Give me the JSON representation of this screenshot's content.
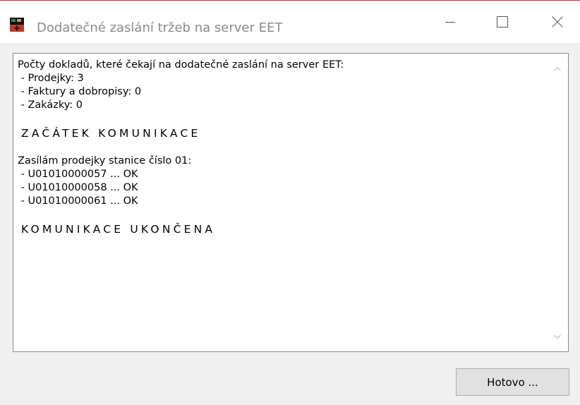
{
  "window": {
    "title": "Dodatečné zaslání tržeb na server EET",
    "icon": "eet-app-icon"
  },
  "controls": {
    "minimize": "minimize-icon",
    "maximize": "maximize-icon",
    "close": "close-icon"
  },
  "log": {
    "l1": "Počty dokladů, které čekají na dodatečné zaslání na server EET:",
    "l2": " - Prodejky: 3",
    "l3": " - Faktury a dobropisy: 0",
    "l4": " - Zakázky: 0",
    "l5": "ZAČÁTEK KOMUNIKACE",
    "l6": "Zasílám prodejky stanice číslo 01:",
    "l7": " - U01010000057 ... OK",
    "l8": " - U01010000058 ... OK",
    "l9": " - U01010000061 ... OK",
    "l10": "KOMUNIKACE UKONČENA"
  },
  "footer": {
    "done_label": "Hotovo ..."
  },
  "colors": {
    "title_text": "#8a8a8a",
    "top_accent": "#b03a3a",
    "button_bg": "#e1e1e1"
  }
}
